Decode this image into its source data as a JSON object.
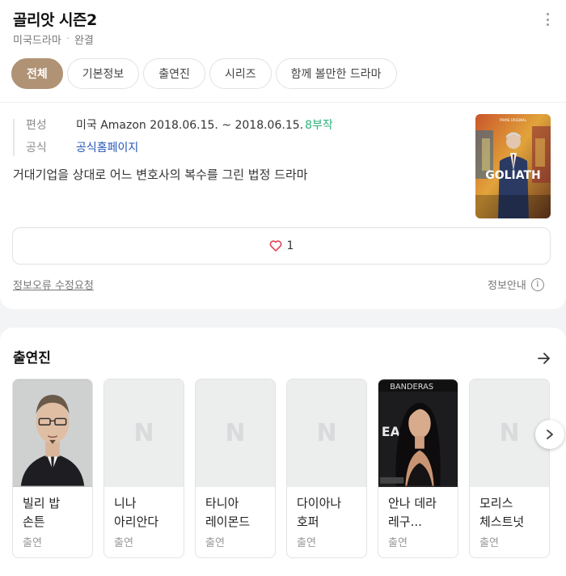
{
  "header": {
    "title": "골리앗 시즌2",
    "genre": "미국드라마",
    "dot": "·",
    "status": "완결"
  },
  "tabs": [
    {
      "label": "전체",
      "active": true
    },
    {
      "label": "기본정보"
    },
    {
      "label": "출연진"
    },
    {
      "label": "시리즈"
    },
    {
      "label": "함께 볼만한 드라마"
    }
  ],
  "info": {
    "broadcast_label": "편성",
    "broadcast_value": "미국 Amazon  2018.06.15. ~ 2018.06.15.",
    "episodes": "8부작",
    "official_label": "공식",
    "official_value": "공식홈페이지",
    "description": "거대기업을 상대로 어느 변호사의 복수를 그린 법정 드라마"
  },
  "poster": {
    "top_text": "PRIME ORIGINAL",
    "title": "GOLIATH"
  },
  "like": {
    "count": "1"
  },
  "footer": {
    "report": "정보오류 수정요청",
    "guide": "정보안내",
    "guide_icon": "i"
  },
  "cast": {
    "title": "출연진",
    "items": [
      {
        "name": "빌리 밥 손튼",
        "role": "출연",
        "photo": "portrait"
      },
      {
        "name": "니나 아리안다",
        "role": "출연",
        "photo": "placeholder"
      },
      {
        "name": "타니아 레이몬드",
        "role": "출연",
        "photo": "placeholder"
      },
      {
        "name": "다이아나 호퍼",
        "role": "출연",
        "photo": "placeholder"
      },
      {
        "name": "안나 데라 레구...",
        "role": "출연",
        "photo": "portrait",
        "photo_text": "BANDERAS"
      },
      {
        "name": "모리스 체스트넛",
        "role": "출연",
        "photo": "placeholder"
      }
    ],
    "placeholder_glyph": "N"
  },
  "colors": {
    "accent": "#b09274",
    "episodes": "#2db27d",
    "link": "#2755b8"
  }
}
